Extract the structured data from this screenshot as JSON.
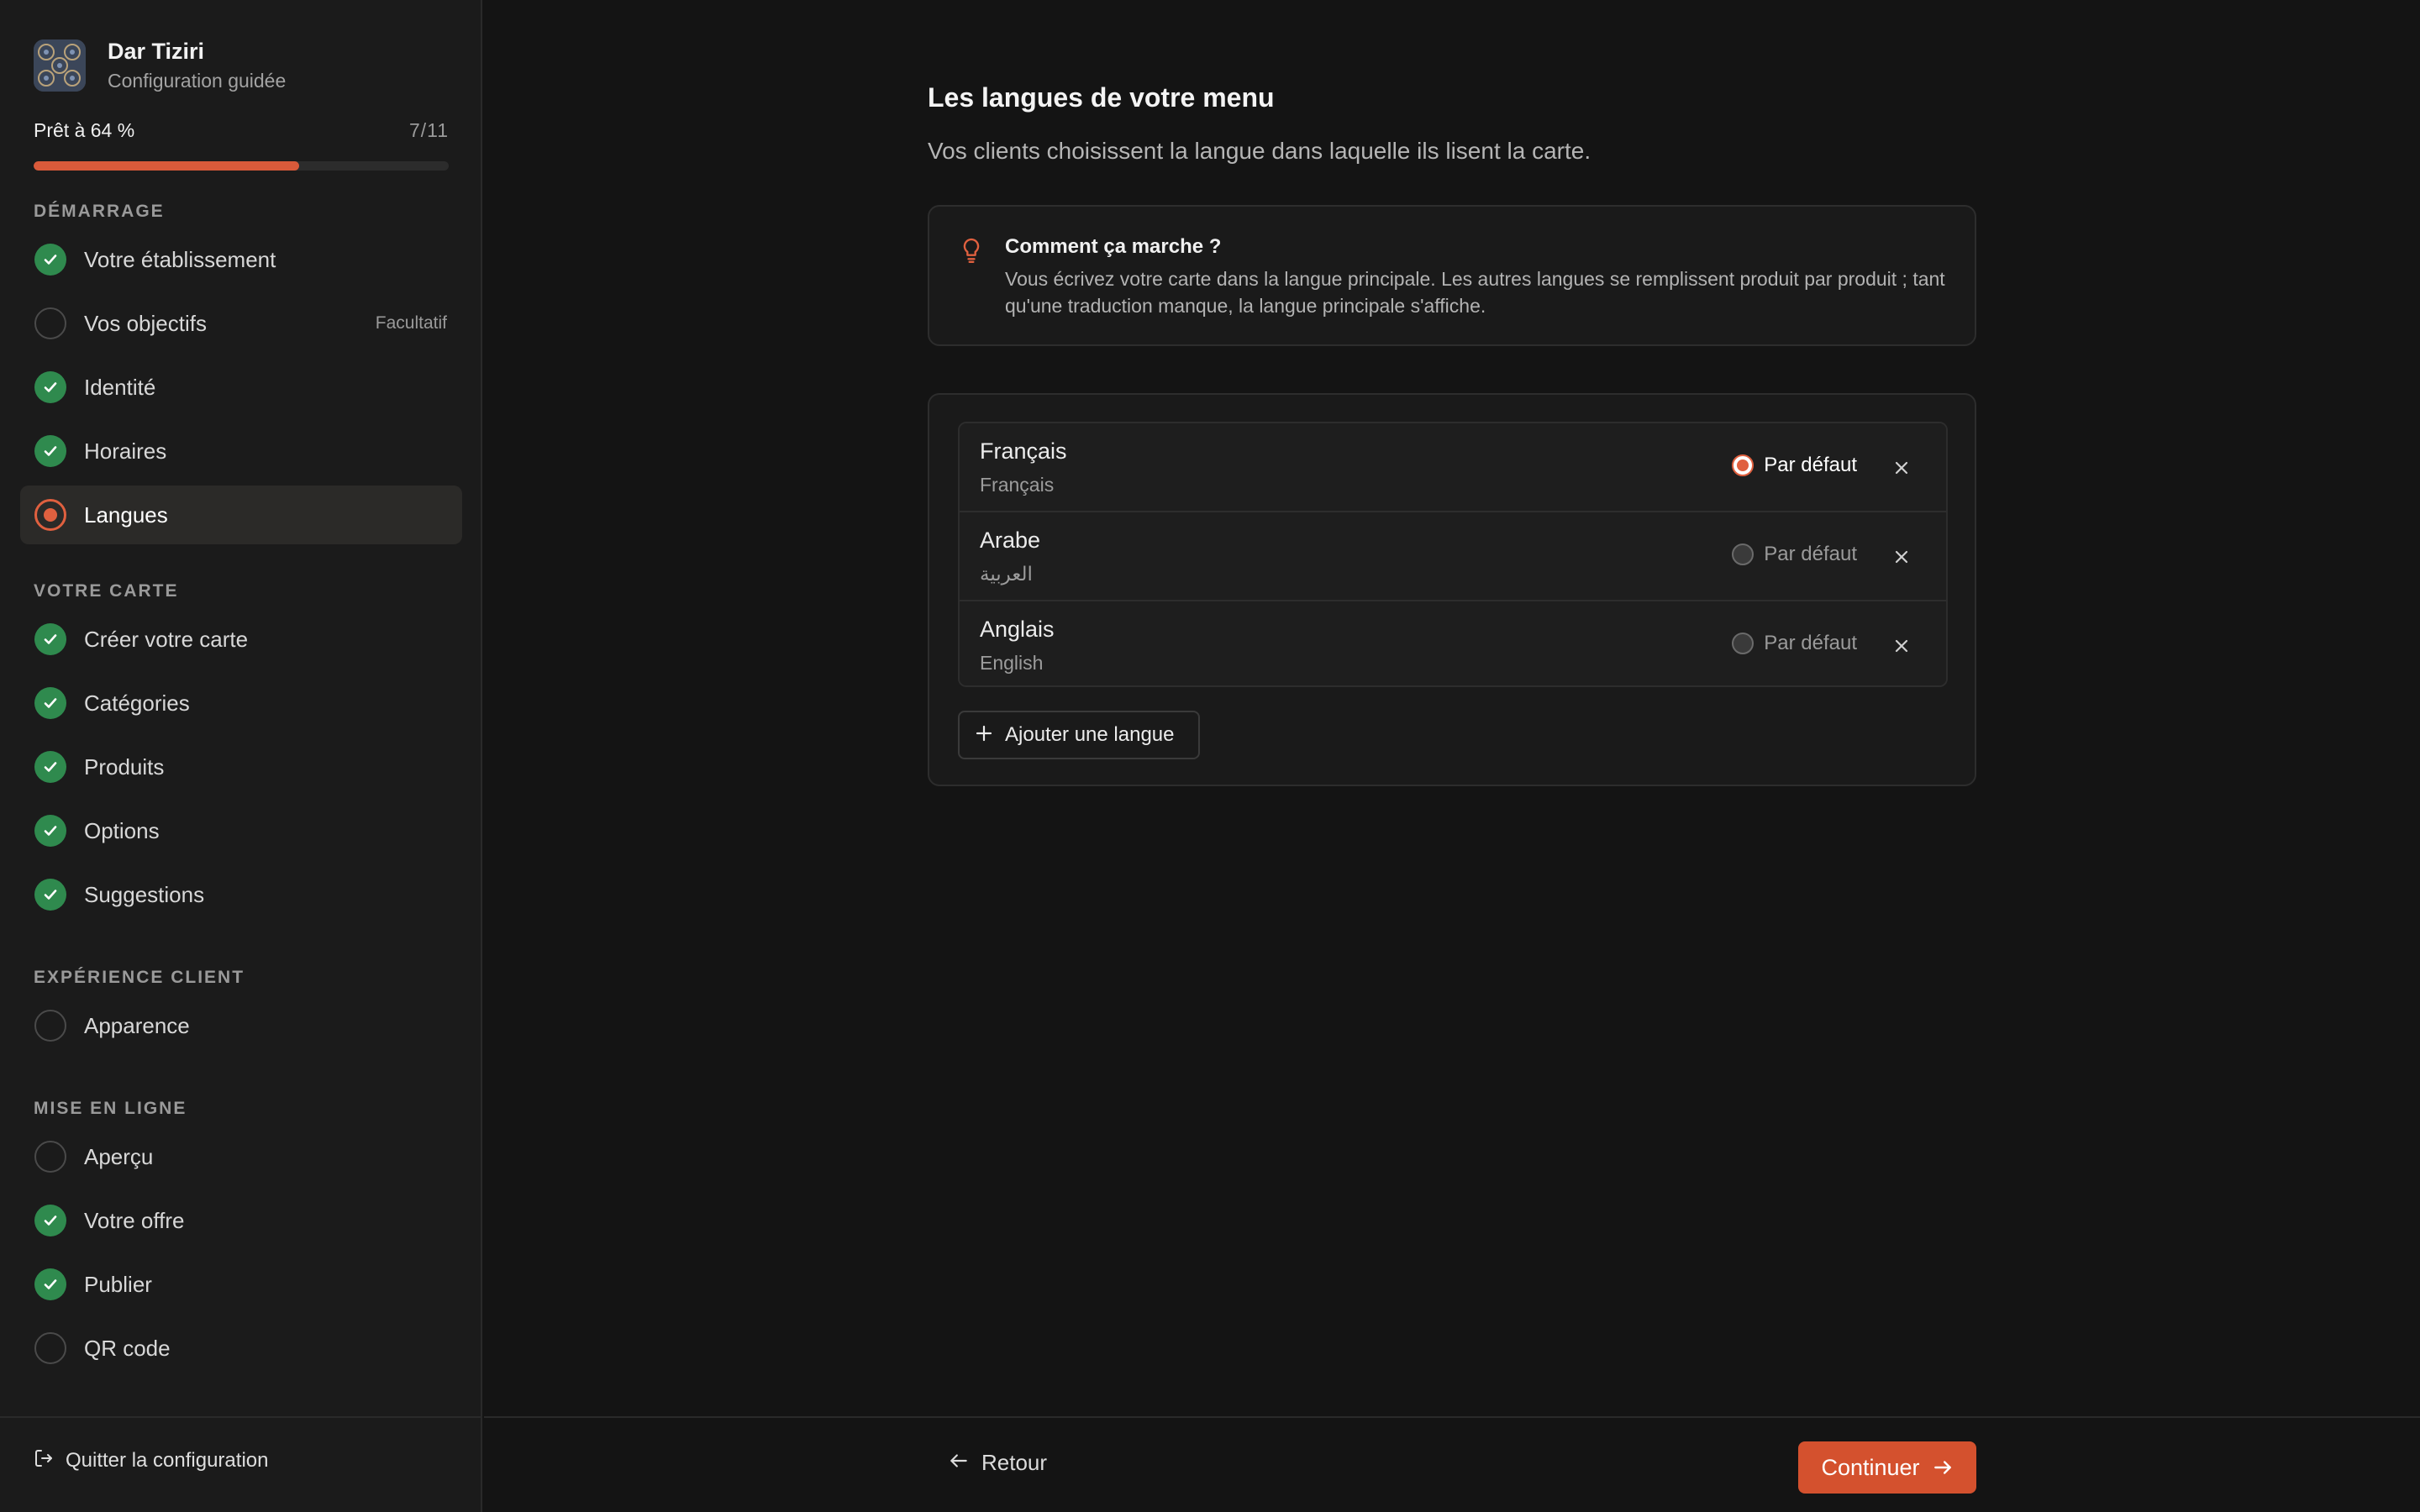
{
  "brand": {
    "name": "Dar Tiziri",
    "subtitle": "Configuration guidée"
  },
  "progress": {
    "label": "Prêt à 64 %",
    "count": "7/11",
    "value": 0.64
  },
  "sidebar": {
    "sections": [
      {
        "title": "DÉMARRAGE",
        "items": [
          {
            "label": "Votre établissement",
            "status": "done"
          },
          {
            "label": "Vos objectifs",
            "status": "todo",
            "tag": "Facultatif"
          },
          {
            "label": "Identité",
            "status": "done"
          },
          {
            "label": "Horaires",
            "status": "done"
          },
          {
            "label": "Langues",
            "status": "current"
          }
        ]
      },
      {
        "title": "VOTRE CARTE",
        "items": [
          {
            "label": "Créer votre carte",
            "status": "done"
          },
          {
            "label": "Catégories",
            "status": "done"
          },
          {
            "label": "Produits",
            "status": "done"
          },
          {
            "label": "Options",
            "status": "done"
          },
          {
            "label": "Suggestions",
            "status": "done"
          }
        ]
      },
      {
        "title": "EXPÉRIENCE CLIENT",
        "items": [
          {
            "label": "Apparence",
            "status": "todo"
          }
        ]
      },
      {
        "title": "MISE EN LIGNE",
        "items": [
          {
            "label": "Aperçu",
            "status": "todo"
          },
          {
            "label": "Votre offre",
            "status": "done"
          },
          {
            "label": "Publier",
            "status": "done"
          },
          {
            "label": "QR code",
            "status": "todo"
          }
        ]
      }
    ],
    "quit_label": "Quitter la configuration"
  },
  "main": {
    "title": "Les langues de votre menu",
    "subtitle": "Vos clients choisissent la langue dans laquelle ils lisent la carte.",
    "info": {
      "title": "Comment ça marche ?",
      "body": "Vous écrivez votre carte dans la langue principale. Les autres langues se remplissent produit par produit ; tant qu'une traduction manque, la langue principale s'affiche."
    },
    "languages": [
      {
        "name": "Français",
        "native": "Français",
        "default_label": "Par défaut",
        "is_default": true
      },
      {
        "name": "Arabe",
        "native": "العربية",
        "default_label": "Par défaut",
        "is_default": false
      },
      {
        "name": "Anglais",
        "native": "English",
        "default_label": "Par défaut",
        "is_default": false
      }
    ],
    "add_language_label": "Ajouter une langue"
  },
  "footer": {
    "back_label": "Retour",
    "continue_label": "Continuer"
  },
  "colors": {
    "accent": "#d4512e",
    "success": "#2f8a4e",
    "background": "#141414",
    "sidebar": "#1b1b1b"
  }
}
